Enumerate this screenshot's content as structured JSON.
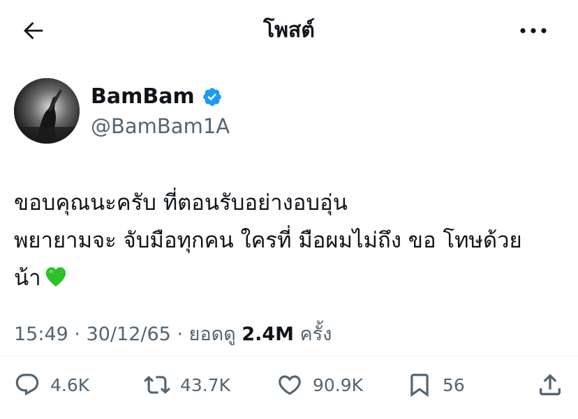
{
  "header": {
    "title": "โพสต์"
  },
  "author": {
    "display_name": "BamBam",
    "handle": "@BamBam1A",
    "verified": true,
    "verified_color": "#1d9bf0"
  },
  "tweet": {
    "lines": [
      "ขอบคุณนะครับ ที่ตอนรับอย่างอบอุ่น",
      "พยายามจะ จับมือทุกคน ใครที่ มือผมไม่ถึง ขอ โทษด้วย",
      "น้า"
    ],
    "emoji": "green-heart"
  },
  "meta": {
    "time": "15:49",
    "date": "30/12/65",
    "views_label": "ยอดดู",
    "views": "2.4M",
    "views_suffix": "ครั้ง"
  },
  "actions": {
    "replies": "4.6K",
    "reposts": "43.7K",
    "likes": "90.9K",
    "bookmarks": "56"
  },
  "colors": {
    "text": "#0f1419",
    "secondary": "#536471",
    "heart": "#2ec22a"
  }
}
